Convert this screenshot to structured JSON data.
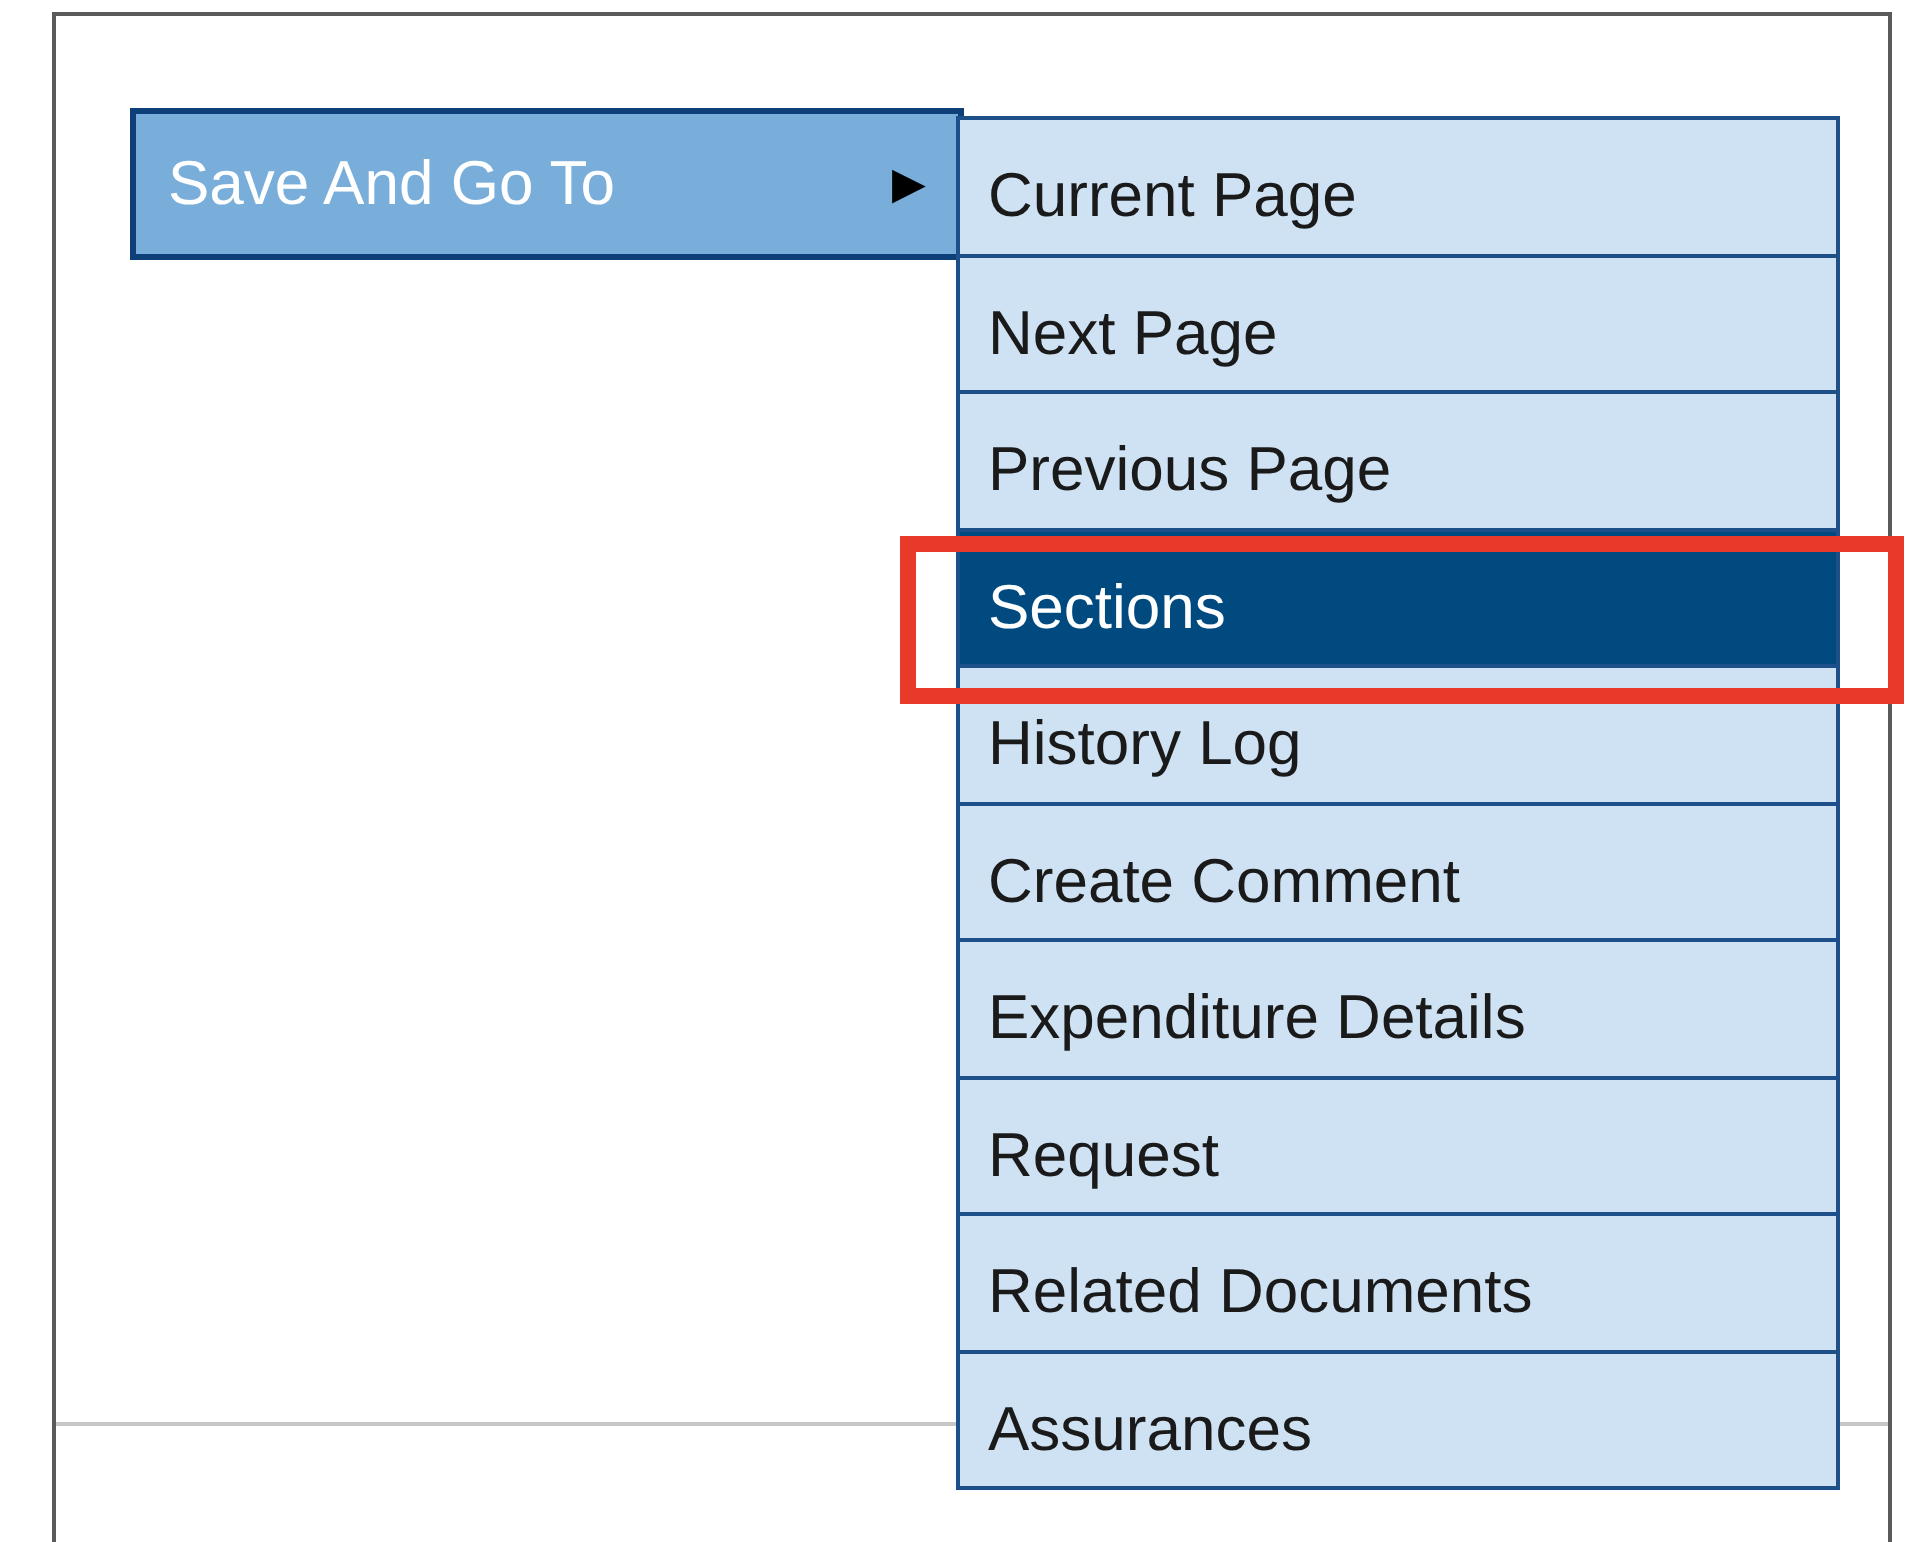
{
  "menu": {
    "label": "Save And Go To",
    "arrow": "▶"
  },
  "submenu": [
    {
      "label": "Current Page",
      "selected": false,
      "highlighted": false
    },
    {
      "label": "Next Page",
      "selected": false,
      "highlighted": false
    },
    {
      "label": "Previous Page",
      "selected": false,
      "highlighted": false
    },
    {
      "label": "Sections",
      "selected": true,
      "highlighted": true
    },
    {
      "label": "History Log",
      "selected": false,
      "highlighted": false
    },
    {
      "label": "Create Comment",
      "selected": false,
      "highlighted": false
    },
    {
      "label": "Expenditure Details",
      "selected": false,
      "highlighted": false
    },
    {
      "label": "Request",
      "selected": false,
      "highlighted": false
    },
    {
      "label": "Related Documents",
      "selected": false,
      "highlighted": false
    },
    {
      "label": "Assurances",
      "selected": false,
      "highlighted": false
    }
  ]
}
